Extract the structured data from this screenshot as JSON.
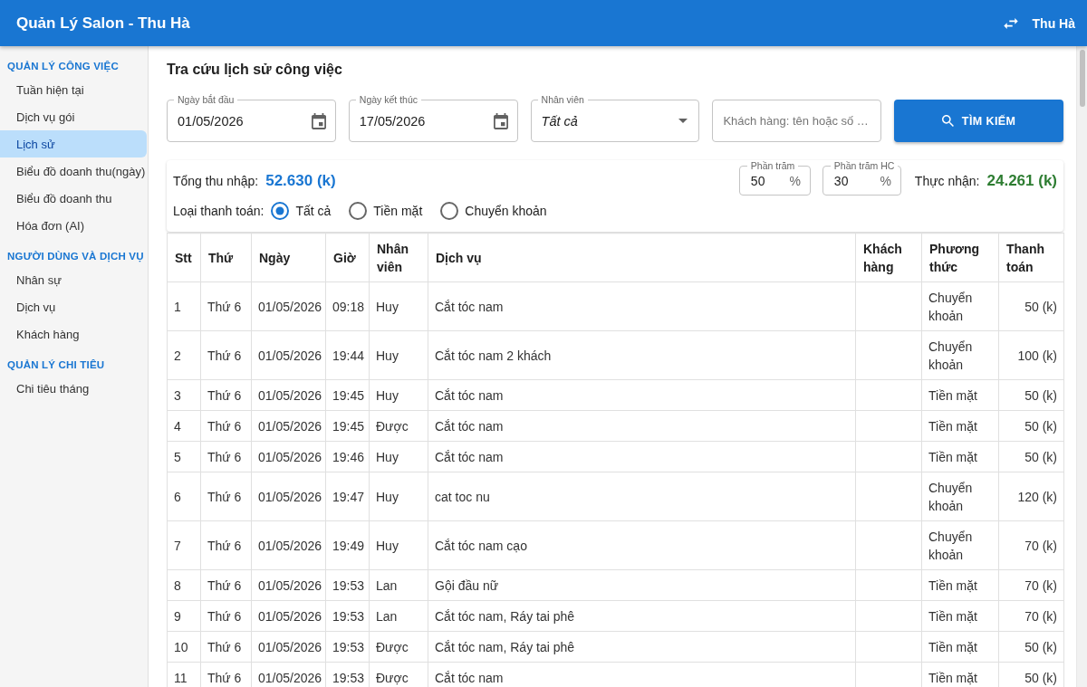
{
  "app_bar": {
    "title": "Quản Lý Salon - Thu Hà",
    "user": "Thu Hà"
  },
  "sidebar": {
    "sections": [
      {
        "heading": "QUẢN LÝ CÔNG VIỆC",
        "items": [
          {
            "label": "Tuần hiện tại",
            "selected": false
          },
          {
            "label": "Dịch vụ gói",
            "selected": false
          },
          {
            "label": "Lịch sử",
            "selected": true
          },
          {
            "label": "Biểu đồ doanh thu(ngày)",
            "selected": false
          },
          {
            "label": "Biểu đồ doanh thu",
            "selected": false
          },
          {
            "label": "Hóa đơn (AI)",
            "selected": false
          }
        ]
      },
      {
        "heading": "NGƯỜI DÙNG VÀ DỊCH VỤ",
        "items": [
          {
            "label": "Nhân sự",
            "selected": false
          },
          {
            "label": "Dịch vụ",
            "selected": false
          },
          {
            "label": "Khách hàng",
            "selected": false
          }
        ]
      },
      {
        "heading": "QUẢN LÝ CHI TIÊU",
        "items": [
          {
            "label": "Chi tiêu tháng",
            "selected": false
          }
        ]
      }
    ]
  },
  "page_title": "Tra cứu lịch sử công việc",
  "filters": [
    {
      "kind": "date",
      "label": "Ngày bắt đầu",
      "value": "01/05/2026"
    },
    {
      "kind": "date",
      "label": "Ngày kết thúc",
      "value": "17/05/2026"
    },
    {
      "kind": "select",
      "label": "Nhân viên",
      "value": "Tất cả"
    },
    {
      "kind": "text",
      "placeholder": "Khách hàng: tên hoặc số …"
    }
  ],
  "search_button": {
    "label": "TÌM KIẾM"
  },
  "summary": {
    "total_label": "Tổng thu nhập:",
    "total_value": "52.630 (k)",
    "percent_fields": [
      {
        "label": "Phần trăm",
        "value": "50",
        "unit": "%"
      },
      {
        "label": "Phần trăm HC",
        "value": "30",
        "unit": "%"
      }
    ],
    "net_label": "Thực nhận:",
    "net_value": "24.261 (k)",
    "payment_label": "Loại thanh toán:",
    "payment_options": [
      {
        "label": "Tất cả",
        "selected": true
      },
      {
        "label": "Tiền mặt",
        "selected": false
      },
      {
        "label": "Chuyển khoản",
        "selected": false
      }
    ]
  },
  "table": {
    "columns": [
      "Stt",
      "Thứ",
      "Ngày",
      "Giờ",
      "Nhân viên",
      "Dịch vụ",
      "Khách hàng",
      "Phương thức",
      "Thanh toán"
    ],
    "rows": [
      {
        "stt": "1",
        "weekday": "Thứ 6",
        "date": "01/05/2026",
        "time": "09:18",
        "staff": "Huy",
        "service": "Cắt tóc nam",
        "payment_method": "Chuyển khoản",
        "amount": "50 (k)"
      },
      {
        "stt": "2",
        "weekday": "Thứ 6",
        "date": "01/05/2026",
        "time": "19:44",
        "staff": "Huy",
        "service": "Cắt tóc nam 2 khách",
        "payment_method": "Chuyển khoản",
        "amount": "100 (k)"
      },
      {
        "stt": "3",
        "weekday": "Thứ 6",
        "date": "01/05/2026",
        "time": "19:45",
        "staff": "Huy",
        "service": "Cắt tóc nam",
        "payment_method": "Tiền mặt",
        "amount": "50 (k)"
      },
      {
        "stt": "4",
        "weekday": "Thứ 6",
        "date": "01/05/2026",
        "time": "19:45",
        "staff": "Được",
        "service": "Cắt tóc nam",
        "payment_method": "Tiền mặt",
        "amount": "50 (k)"
      },
      {
        "stt": "5",
        "weekday": "Thứ 6",
        "date": "01/05/2026",
        "time": "19:46",
        "staff": "Huy",
        "service": "Cắt tóc nam",
        "payment_method": "Tiền mặt",
        "amount": "50 (k)"
      },
      {
        "stt": "6",
        "weekday": "Thứ 6",
        "date": "01/05/2026",
        "time": "19:47",
        "staff": "Huy",
        "service": "cat toc nu",
        "payment_method": "Chuyển khoản",
        "amount": "120 (k)"
      },
      {
        "stt": "7",
        "weekday": "Thứ 6",
        "date": "01/05/2026",
        "time": "19:49",
        "staff": "Huy",
        "service": "Cắt tóc nam cạo",
        "payment_method": "Chuyển khoản",
        "amount": "70 (k)"
      },
      {
        "stt": "8",
        "weekday": "Thứ 6",
        "date": "01/05/2026",
        "time": "19:53",
        "staff": "Lan",
        "service": "Gội đầu nữ",
        "payment_method": "Tiền mặt",
        "amount": "70 (k)"
      },
      {
        "stt": "9",
        "weekday": "Thứ 6",
        "date": "01/05/2026",
        "time": "19:53",
        "staff": "Lan",
        "service": "Cắt tóc nam, Ráy tai phê",
        "payment_method": "Tiền mặt",
        "amount": "70 (k)"
      },
      {
        "stt": "10",
        "weekday": "Thứ 6",
        "date": "01/05/2026",
        "time": "19:53",
        "staff": "Được",
        "service": "Cắt tóc nam, Ráy tai phê",
        "payment_method": "Tiền mặt",
        "amount": "50 (k)"
      },
      {
        "stt": "11",
        "weekday": "Thứ 6",
        "date": "01/05/2026",
        "time": "19:53",
        "staff": "Được",
        "service": "Cắt tóc nam",
        "payment_method": "Tiền mặt",
        "amount": "50 (k)"
      }
    ]
  }
}
